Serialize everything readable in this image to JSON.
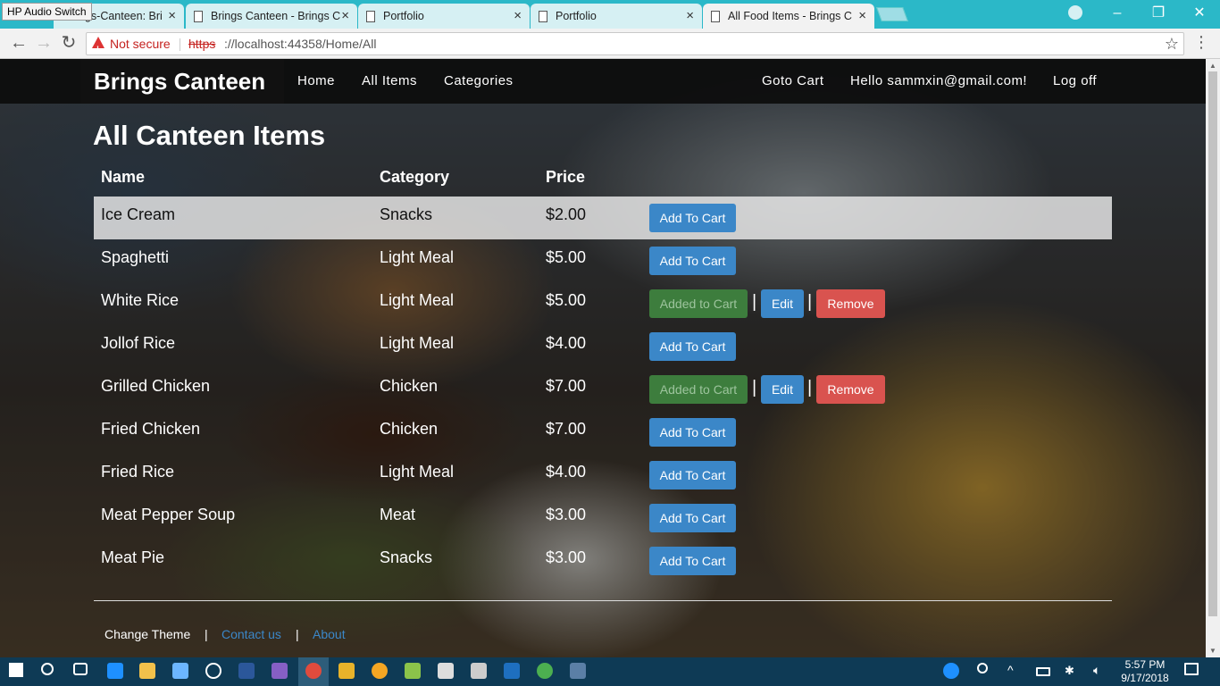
{
  "browser": {
    "overlay_label": "HP Audio Switch",
    "tabs": [
      {
        "title": "ngs-Canteen: Bri",
        "active": false
      },
      {
        "title": "Brings Canteen - Brings C",
        "active": false
      },
      {
        "title": "Portfolio",
        "active": false
      },
      {
        "title": "Portfolio",
        "active": false
      },
      {
        "title": "All Food Items - Brings C",
        "active": true
      }
    ],
    "security_label": "Not secure",
    "url_scheme": "https",
    "url_rest": "://localhost:44358/Home/All"
  },
  "navbar": {
    "brand": "Brings Canteen",
    "links": [
      "Home",
      "All Items",
      "Categories"
    ],
    "cart": "Goto Cart",
    "greeting": "Hello sammxin@gmail.com!",
    "logoff": "Log off"
  },
  "main": {
    "title": "All Canteen Items",
    "columns": [
      "Name",
      "Category",
      "Price"
    ],
    "buttons": {
      "add": "Add To Cart",
      "added": "Added to Cart",
      "edit": "Edit",
      "remove": "Remove",
      "separator": "|"
    },
    "rows": [
      {
        "name": "Ice Cream",
        "category": "Snacks",
        "price": "$2.00",
        "in_cart": false
      },
      {
        "name": "Spaghetti",
        "category": "Light Meal",
        "price": "$5.00",
        "in_cart": false
      },
      {
        "name": "White Rice",
        "category": "Light Meal",
        "price": "$5.00",
        "in_cart": true
      },
      {
        "name": "Jollof Rice",
        "category": "Light Meal",
        "price": "$4.00",
        "in_cart": false
      },
      {
        "name": "Grilled Chicken",
        "category": "Chicken",
        "price": "$7.00",
        "in_cart": true
      },
      {
        "name": "Fried Chicken",
        "category": "Chicken",
        "price": "$7.00",
        "in_cart": false
      },
      {
        "name": "Fried Rice",
        "category": "Light Meal",
        "price": "$4.00",
        "in_cart": false
      },
      {
        "name": "Meat Pepper Soup",
        "category": "Meat",
        "price": "$3.00",
        "in_cart": false
      },
      {
        "name": "Meat Pie",
        "category": "Snacks",
        "price": "$3.00",
        "in_cart": false
      }
    ]
  },
  "footer": {
    "change_theme": "Change Theme",
    "separator": "|",
    "contact": "Contact us",
    "about": "About"
  },
  "taskbar": {
    "time": "5:57 PM",
    "date": "9/17/2018"
  },
  "colors": {
    "primary_button": "#3b87c8",
    "added_button": "#3d7d3d",
    "remove_button": "#d9534f",
    "link": "#3b87c8",
    "tabstrip": "#2bb8c8"
  }
}
